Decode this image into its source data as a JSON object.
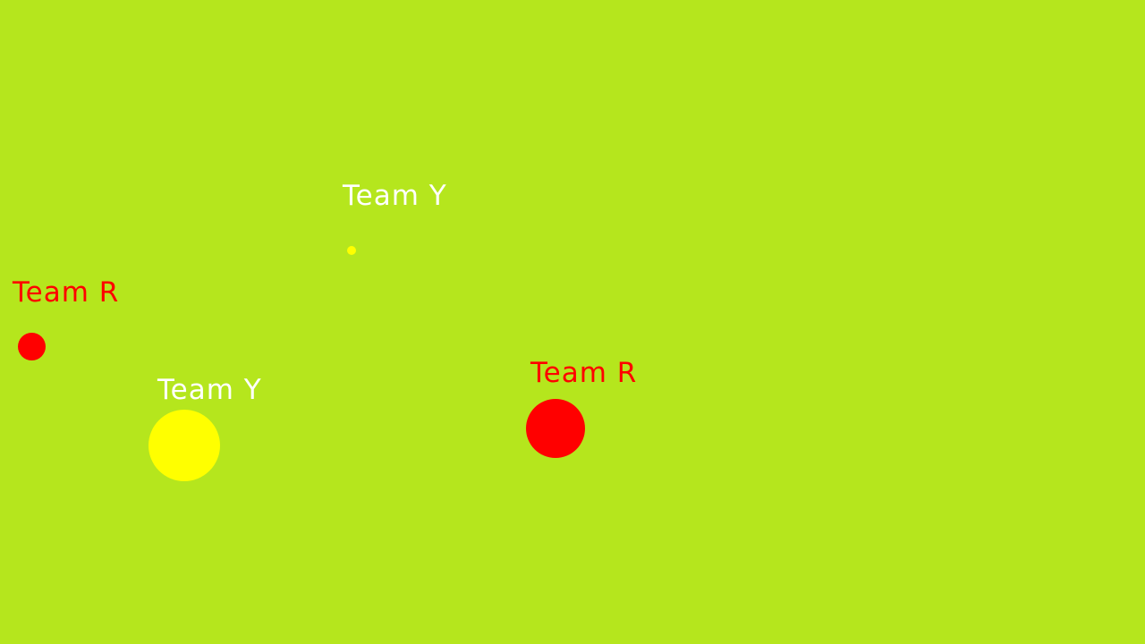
{
  "colors": {
    "field": "#b5e61d",
    "team_r": "#ff0000",
    "team_y": "#ffff00",
    "team_y_label": "#ffffff"
  },
  "players": [
    {
      "team": "R",
      "label": "Team R"
    },
    {
      "team": "Y",
      "label": "Team Y"
    },
    {
      "team": "Y",
      "label": "Team Y"
    },
    {
      "team": "R",
      "label": "Team R"
    }
  ]
}
